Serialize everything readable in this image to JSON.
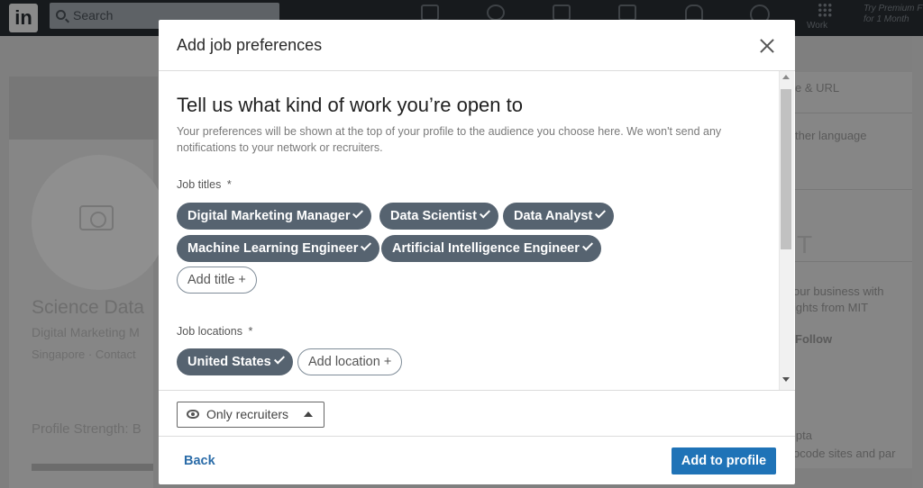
{
  "background": {
    "logo": "in",
    "search_placeholder": "Search",
    "work_label": "Work",
    "premium_line1": "Try Premium F",
    "premium_line2": "for 1 Month",
    "profile_name": "Science Data",
    "profile_headline": "Digital Marketing M",
    "profile_location": "Singapore · Contact",
    "profile_strength": "Profile Strength: B",
    "right_panel": [
      "e & URL",
      "ther language",
      "T",
      "our business with",
      "ights from MIT",
      "Follow",
      "ipta",
      "ocode sites and par"
    ]
  },
  "modal": {
    "title": "Add job preferences",
    "heading": "Tell us what kind of work you’re open to",
    "description": "Your preferences will be shown at the top of your profile to the audience you choose here. We won't send any notifications to your network or recruiters.",
    "job_titles_label": "Job titles",
    "required_mark": "*",
    "job_titles": [
      "Digital Marketing Manager",
      "Data Scientist",
      "Data Analyst",
      "Machine Learning Engineer",
      "Artificial Intelligence Engineer"
    ],
    "add_title_label": "Add title +",
    "job_locations_label": "Job locations",
    "job_locations": [
      "United States"
    ],
    "add_location_label": "Add location +",
    "visibility_label": "Only recruiters",
    "back_label": "Back",
    "submit_label": "Add to profile"
  }
}
